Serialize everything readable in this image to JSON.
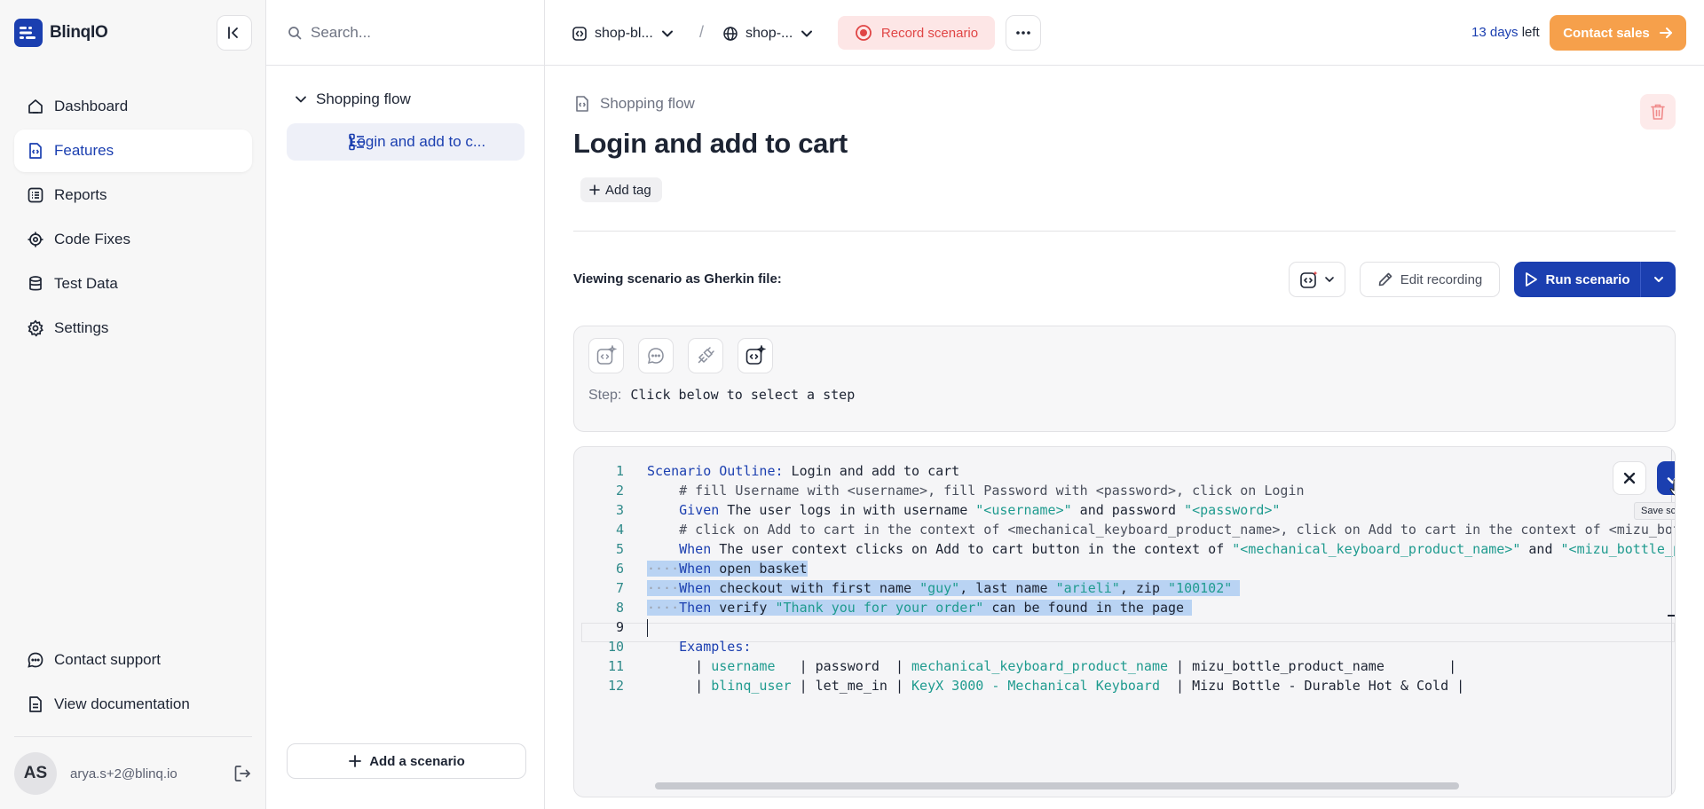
{
  "app": {
    "name": "BlinqIO"
  },
  "sidebar": {
    "items": [
      {
        "label": "Dashboard",
        "icon": "home-icon"
      },
      {
        "label": "Features",
        "icon": "feature-file-icon",
        "active": true
      },
      {
        "label": "Reports",
        "icon": "list-icon"
      },
      {
        "label": "Code Fixes",
        "icon": "code-gear-icon"
      },
      {
        "label": "Test Data",
        "icon": "database-icon"
      },
      {
        "label": "Settings",
        "icon": "gear-icon"
      }
    ],
    "bottom": [
      {
        "label": "Contact support",
        "icon": "chat-icon"
      },
      {
        "label": "View documentation",
        "icon": "document-icon"
      }
    ],
    "user": {
      "initials": "AS",
      "email": "arya.s+2@blinq.io"
    }
  },
  "tree": {
    "search_placeholder": "Search...",
    "folder": "Shopping flow",
    "item": "Login and add to c...",
    "add_scenario": "Add a scenario"
  },
  "topbar": {
    "project": "shop-bl...",
    "environment": "shop-...",
    "record": "Record scenario",
    "trial_days": "13 days",
    "trial_suffix": " left",
    "contact_sales": "Contact sales"
  },
  "main": {
    "feature_name": "Shopping flow",
    "title": "Login and add to cart",
    "add_tag": "Add tag",
    "viewing_label": "Viewing scenario as Gherkin file:",
    "edit_recording": "Edit recording",
    "run_scenario": "Run scenario",
    "step_label": "Step:",
    "step_text": "Click below to select a step",
    "save_tooltip": "Save scenario"
  },
  "editor": {
    "lines": [
      {
        "n": "1",
        "parts": [
          [
            "kw",
            "Scenario Outline:"
          ],
          [
            "",
            " Login and add to cart"
          ]
        ]
      },
      {
        "n": "2",
        "parts": [
          [
            "cm",
            "    # fill Username with <username>, fill Password with <password>, click on Login"
          ]
        ]
      },
      {
        "n": "3",
        "parts": [
          [
            "",
            "    "
          ],
          [
            "kw",
            "Given"
          ],
          [
            "",
            " The user logs in with username "
          ],
          [
            "st",
            "\"<username>\""
          ],
          [
            "",
            " and password "
          ],
          [
            "st",
            "\"<password>\""
          ]
        ]
      },
      {
        "n": "4",
        "parts": [
          [
            "cm",
            "    # click on Add to cart in the context of <mechanical_keyboard_product_name>, click on Add to cart in the context of <mizu_bottle_product_name>"
          ]
        ]
      },
      {
        "n": "5",
        "parts": [
          [
            "",
            "    "
          ],
          [
            "kw",
            "When"
          ],
          [
            "",
            " The user context clicks on Add to cart button in the context of "
          ],
          [
            "st",
            "\"<mechanical_keyboard_product_name>\""
          ],
          [
            "",
            " and "
          ],
          [
            "st",
            "\"<mizu_bottle_product_name>\""
          ]
        ]
      },
      {
        "n": "6",
        "sel": true,
        "parts": [
          [
            "ws",
            "····"
          ],
          [
            "kw",
            "When"
          ],
          [
            "",
            " open basket"
          ]
        ]
      },
      {
        "n": "7",
        "sel": true,
        "parts": [
          [
            "ws",
            "····"
          ],
          [
            "kw",
            "When"
          ],
          [
            "",
            " checkout with first name "
          ],
          [
            "st",
            "\"guy\""
          ],
          [
            "",
            ", last name "
          ],
          [
            "st",
            "\"arieli\""
          ],
          [
            "",
            ", zip "
          ],
          [
            "st",
            "\"100102\""
          ],
          [
            "",
            " "
          ]
        ]
      },
      {
        "n": "8",
        "sel": true,
        "parts": [
          [
            "ws",
            "····"
          ],
          [
            "kw",
            "Then"
          ],
          [
            "",
            " verify "
          ],
          [
            "st",
            "\"Thank you for your order\""
          ],
          [
            "",
            " can be found in the page "
          ]
        ]
      },
      {
        "n": "9",
        "cur": true,
        "parts": []
      },
      {
        "n": "10",
        "parts": [
          [
            "",
            "    "
          ],
          [
            "kw",
            "Examples:"
          ]
        ]
      },
      {
        "n": "11",
        "parts": [
          [
            "",
            "      | "
          ],
          [
            "st",
            "username"
          ],
          [
            "",
            "   | password  | "
          ],
          [
            "st",
            "mechanical_keyboard_product_name"
          ],
          [
            "",
            " | mizu_bottle_product_name        |"
          ]
        ]
      },
      {
        "n": "12",
        "parts": [
          [
            "",
            "      | "
          ],
          [
            "st",
            "blinq_user"
          ],
          [
            "",
            " | let_me_in | "
          ],
          [
            "st",
            "KeyX 3000 - Mechanical Keyboard"
          ],
          [
            "",
            "  | Mizu Bottle - Durable Hot & Cold |"
          ]
        ]
      }
    ]
  },
  "colors": {
    "brand": "#1b3fb0",
    "accent_orange": "#f6a04b",
    "record_red": "#e04545"
  }
}
